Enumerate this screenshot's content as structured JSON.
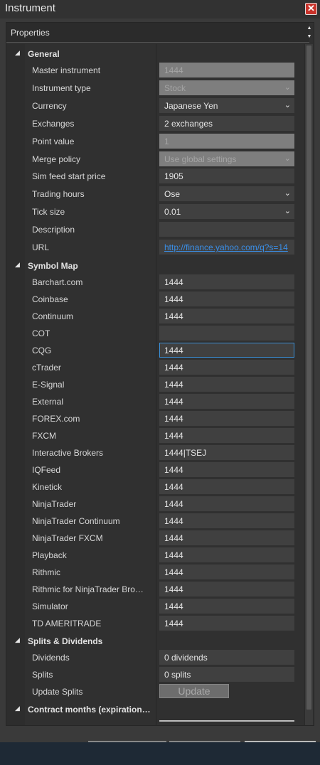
{
  "window": {
    "title": "Instrument",
    "close_glyph": "✕"
  },
  "panel": {
    "title": "Properties",
    "spin_up": "▲",
    "spin_down": "▼"
  },
  "glyphs": {
    "expanded": "◢",
    "chevron": "⌄"
  },
  "colors": {
    "background": "#3a3a3a",
    "field": "#404040",
    "disabled_field": "#7e7e7e",
    "link": "#3a8ee6",
    "focus": "#3b8fd6",
    "close": "#c8322a"
  },
  "general": {
    "label": "General",
    "props": [
      {
        "label": "Master instrument",
        "value": "1444",
        "disabled": true
      },
      {
        "label": "Instrument type",
        "value": "Stock",
        "disabled": true,
        "dropdown": true
      },
      {
        "label": "Currency",
        "value": "Japanese Yen",
        "dropdown": true
      },
      {
        "label": "Exchanges",
        "value": "2 exchanges"
      },
      {
        "label": "Point value",
        "value": "1",
        "disabled": true
      },
      {
        "label": "Merge policy",
        "value": "Use global settings",
        "disabled": true,
        "dropdown": true
      },
      {
        "label": "Sim feed start price",
        "value": "1905"
      },
      {
        "label": "Trading hours",
        "value": "Ose",
        "dropdown": true
      },
      {
        "label": "Tick size",
        "value": "0.01",
        "dropdown": true
      },
      {
        "label": "Description",
        "value": ""
      },
      {
        "label": "URL",
        "value": "http://finance.yahoo.com/q?s=14",
        "link": true
      }
    ]
  },
  "symbol_map": {
    "label": "Symbol Map",
    "props": [
      {
        "label": "Barchart.com",
        "value": "1444"
      },
      {
        "label": "Coinbase",
        "value": "1444"
      },
      {
        "label": "Continuum",
        "value": "1444"
      },
      {
        "label": "COT",
        "value": ""
      },
      {
        "label": "CQG",
        "value": "1444",
        "focused": true
      },
      {
        "label": "cTrader",
        "value": "1444"
      },
      {
        "label": "E-Signal",
        "value": "1444"
      },
      {
        "label": "External",
        "value": "1444"
      },
      {
        "label": "FOREX.com",
        "value": "1444"
      },
      {
        "label": "FXCM",
        "value": "1444"
      },
      {
        "label": "Interactive Brokers",
        "value": "1444|TSEJ"
      },
      {
        "label": "IQFeed",
        "value": "1444"
      },
      {
        "label": "Kinetick",
        "value": "1444"
      },
      {
        "label": "NinjaTrader",
        "value": "1444"
      },
      {
        "label": "NinjaTrader Continuum",
        "value": "1444"
      },
      {
        "label": "NinjaTrader FXCM",
        "value": "1444"
      },
      {
        "label": "Playback",
        "value": "1444"
      },
      {
        "label": "Rithmic",
        "value": "1444"
      },
      {
        "label": "Rithmic for NinjaTrader Bro…",
        "value": "1444"
      },
      {
        "label": "Simulator",
        "value": "1444"
      },
      {
        "label": "TD AMERITRADE",
        "value": "1444"
      }
    ]
  },
  "splits_dividends": {
    "label": "Splits & Dividends",
    "props": [
      {
        "label": "Dividends",
        "value": "0 dividends"
      },
      {
        "label": "Splits",
        "value": "0 splits"
      },
      {
        "label": "Update Splits",
        "button": "Update"
      }
    ]
  },
  "contract_months": {
    "label": "Contract months (expiration…"
  }
}
